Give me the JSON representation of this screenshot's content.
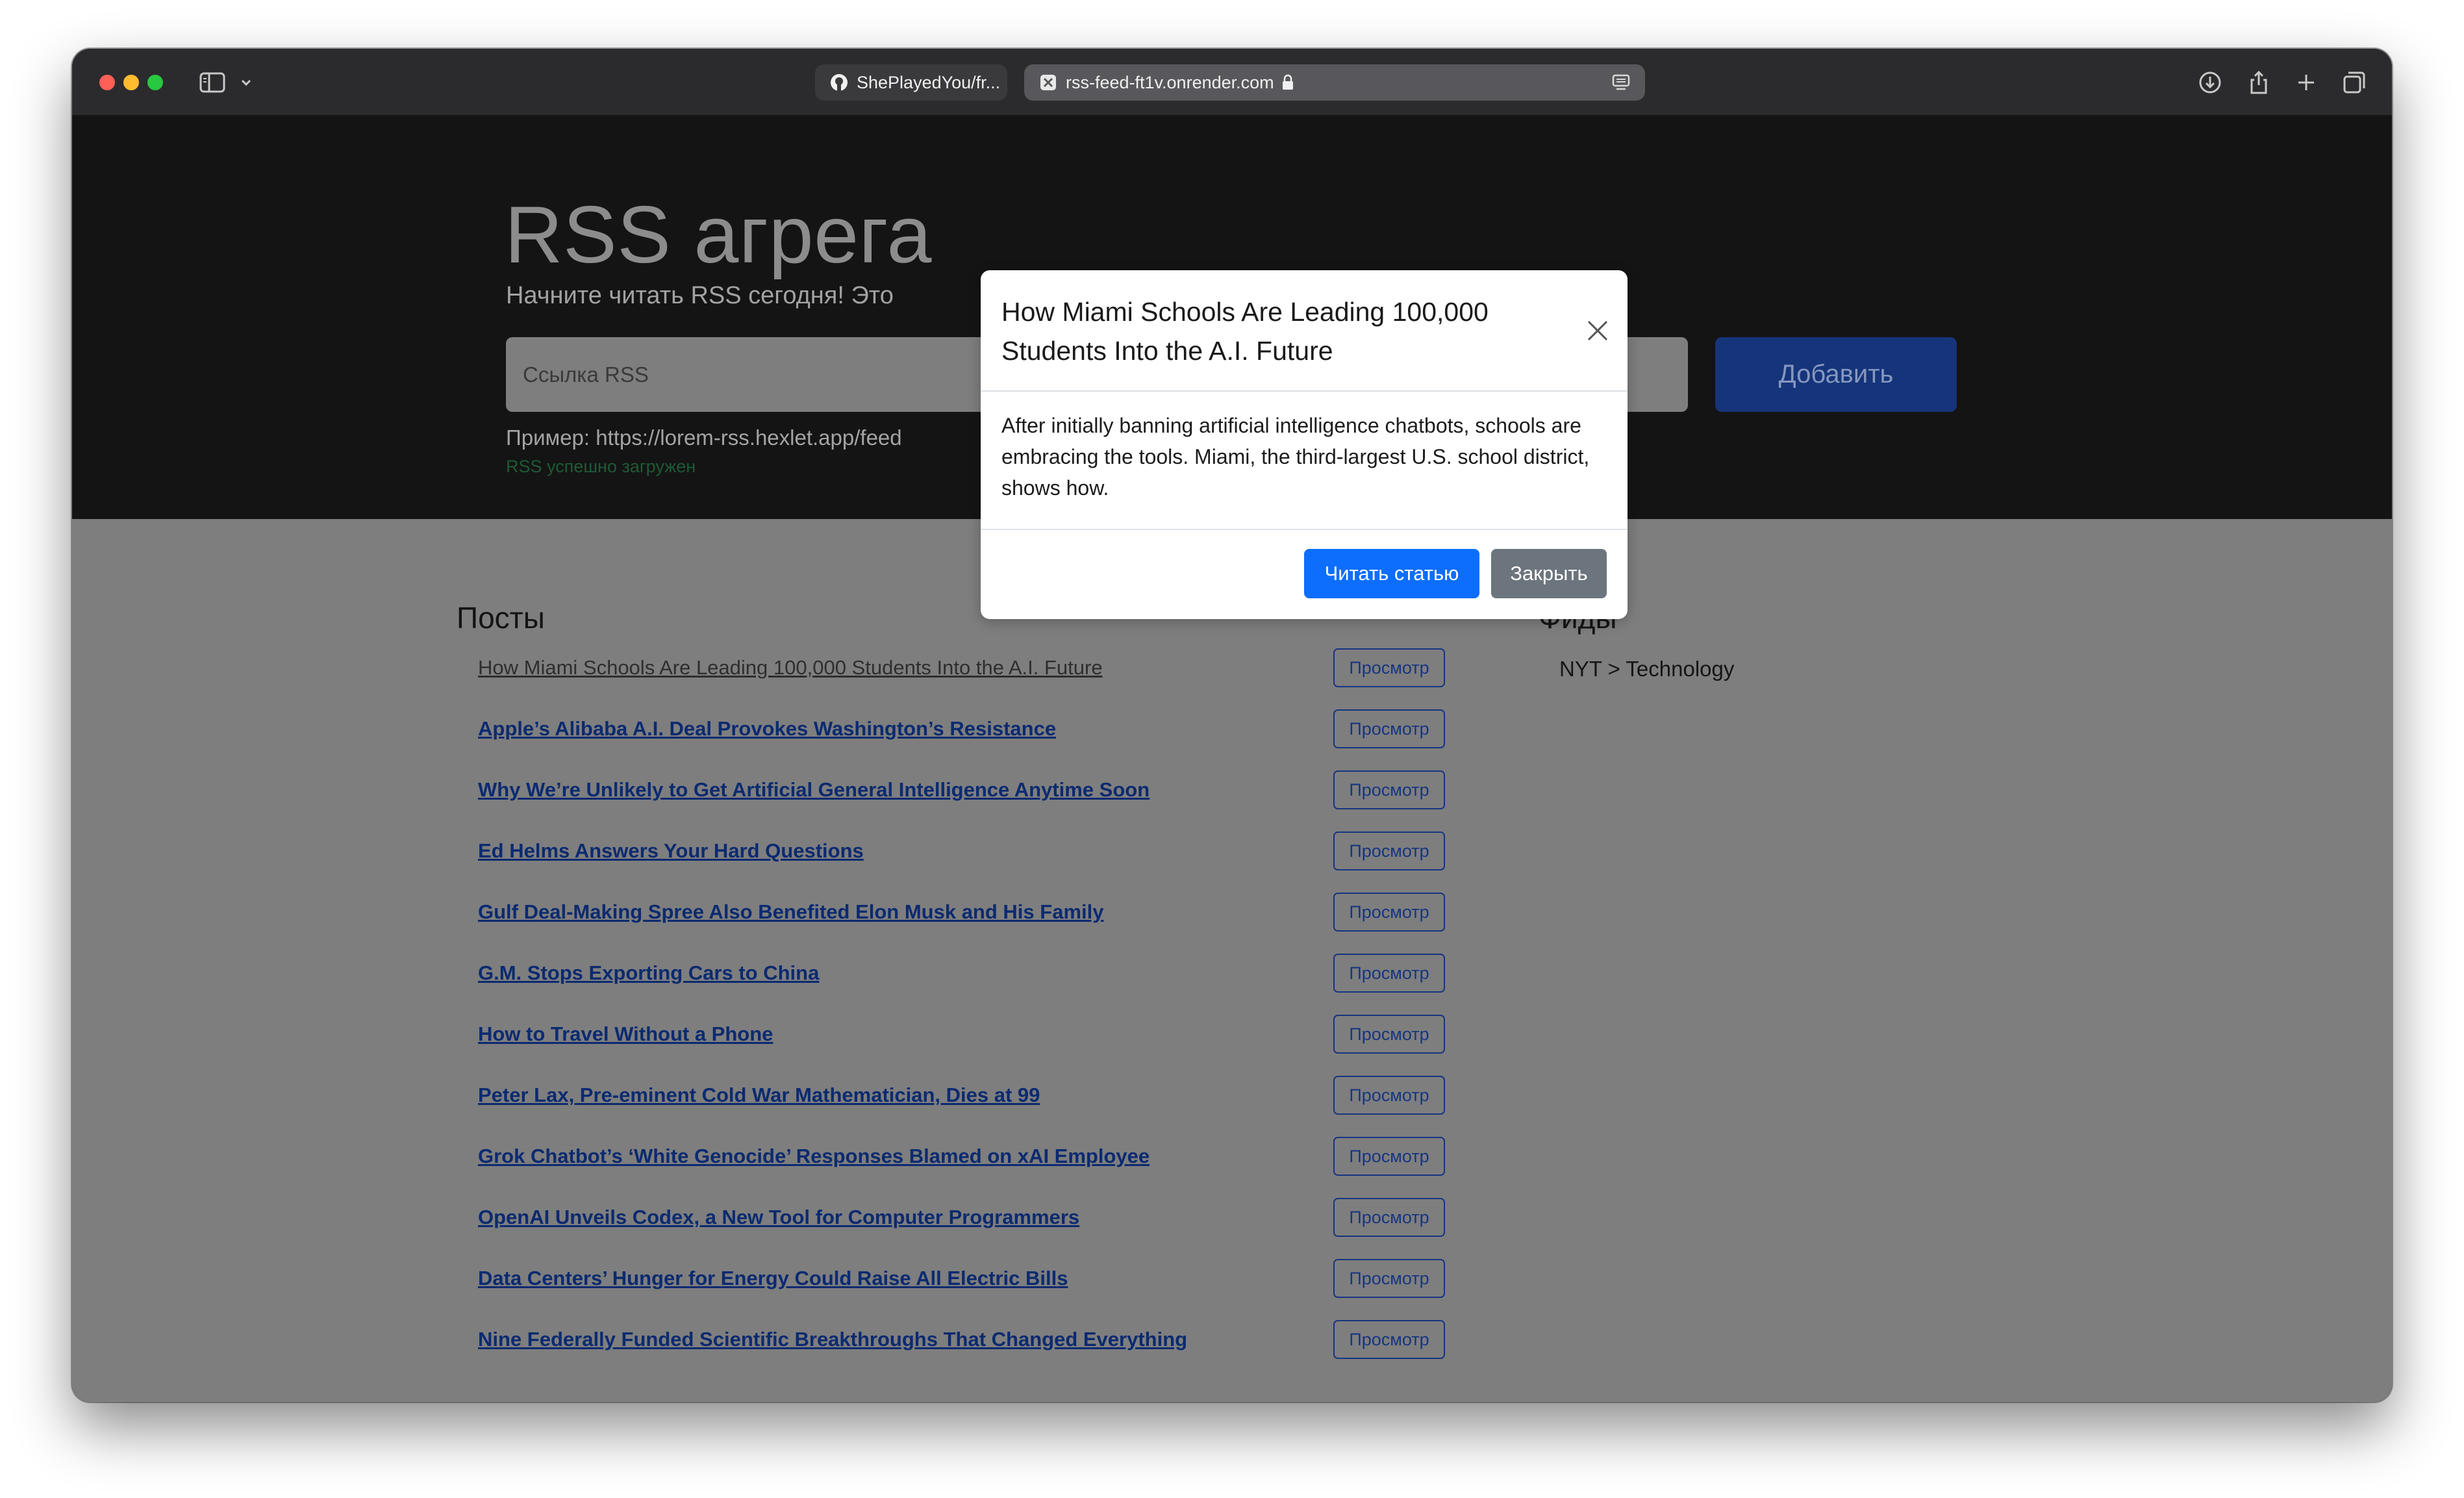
{
  "browser": {
    "tabs": [
      {
        "label": "ShePlayedYou/fr..."
      },
      {
        "label": "rss-feed-ft1v.onrender.com"
      }
    ]
  },
  "hero": {
    "title": "RSS агрега",
    "lead": "Начните читать RSS сегодня! Это",
    "input_placeholder": "Ссылка RSS",
    "add_label": "Добавить",
    "example": "Пример: https://lorem-rss.hexlet.app/feed",
    "feedback": "RSS успешно загружен"
  },
  "posts": {
    "title": "Посты",
    "view_label": "Просмотр",
    "items": [
      {
        "title": "How Miami Schools Are Leading 100,000 Students Into the A.I. Future",
        "visited": true
      },
      {
        "title": "Apple’s Alibaba A.I. Deal Provokes Washington’s Resistance",
        "visited": false
      },
      {
        "title": "Why We’re Unlikely to Get Artificial General Intelligence Anytime Soon",
        "visited": false
      },
      {
        "title": "Ed Helms Answers Your Hard Questions",
        "visited": false
      },
      {
        "title": "Gulf Deal-Making Spree Also Benefited Elon Musk and His Family",
        "visited": false
      },
      {
        "title": "G.M. Stops Exporting Cars to China",
        "visited": false
      },
      {
        "title": "How to Travel Without a Phone",
        "visited": false
      },
      {
        "title": "Peter Lax, Pre-eminent Cold War Mathematician, Dies at 99",
        "visited": false
      },
      {
        "title": "Grok Chatbot’s ‘White Genocide’ Responses Blamed on xAI Employee",
        "visited": false
      },
      {
        "title": "OpenAI Unveils Codex, a New Tool for Computer Programmers",
        "visited": false
      },
      {
        "title": "Data Centers’ Hunger for Energy Could Raise All Electric Bills",
        "visited": false
      },
      {
        "title": "Nine Federally Funded Scientific Breakthroughs That Changed Everything",
        "visited": false
      }
    ]
  },
  "feeds": {
    "title": "Фиды",
    "items": [
      {
        "title": "NYT > Technology"
      }
    ]
  },
  "modal": {
    "title": "How Miami Schools Are Leading 100,000 Students Into the A.I. Future",
    "body": "After initially banning artificial intelligence chatbots, schools are embracing the tools. Miami, the third-largest U.S. school district, shows how.",
    "read_label": "Читать статью",
    "close_label": "Закрыть"
  },
  "colors": {
    "primary": "#0d6efd",
    "secondary": "#6c757d",
    "success": "#198754"
  }
}
